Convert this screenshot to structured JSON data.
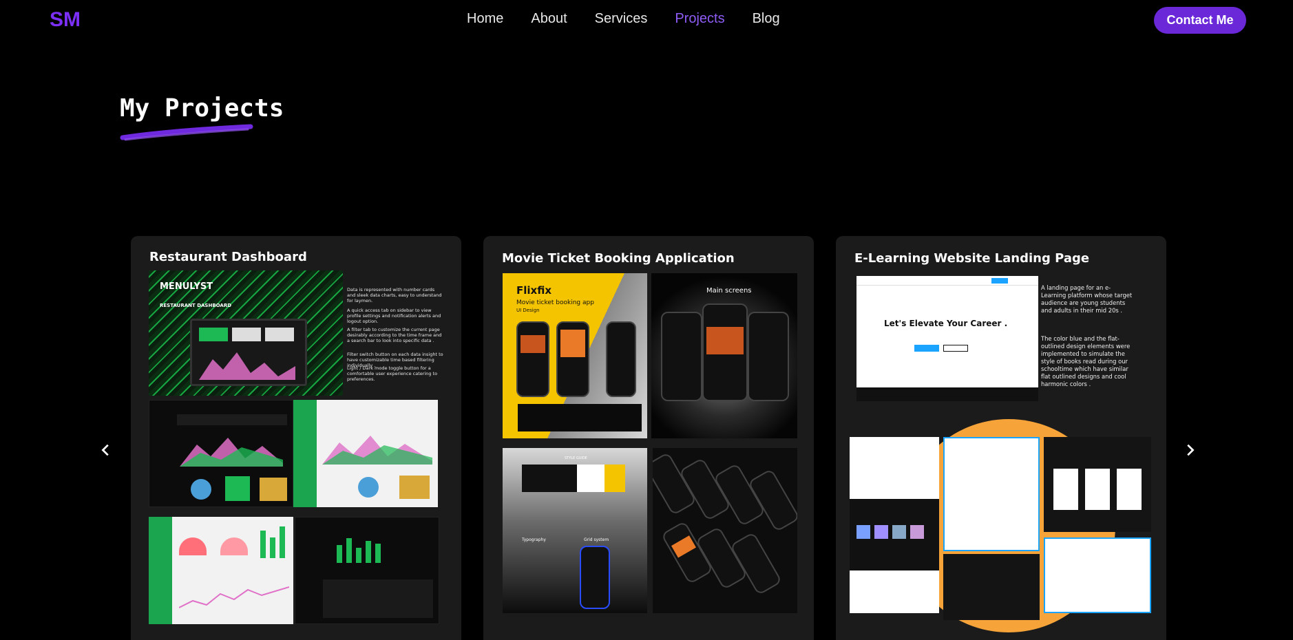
{
  "nav": {
    "logo": "SM",
    "links": [
      "Home",
      "About",
      "Services",
      "Projects",
      "Blog"
    ],
    "active": "Projects",
    "contact_label": "Contact Me"
  },
  "colors": {
    "accent": "#6a28d9",
    "logo": "#7b2ff7",
    "active_link": "#8f5cf6",
    "card_bg": "#1b1b1b",
    "bg": "#000000"
  },
  "section": {
    "title": "My Projects"
  },
  "projects": [
    {
      "title": "Restaurant Dashboard",
      "art": {
        "brand": "MENULYST",
        "brand_sub": "RESTAURANT DASHBOARD",
        "notes": [
          "Data is represented with number cards and sleek data charts, easy to understand for laymen.",
          "A quick access tab on sidebar to view profile settings and notification alerts and logout option.",
          "A filter tab to customize the current page desirably according to the time frame and a search bar to look into specific data .",
          "Filter switch button on each data insight to have customizable time based filtering individually .",
          "Light / Dark mode toggle button for a comfortable user experience catering to preferences."
        ]
      }
    },
    {
      "title": "Movie Ticket Booking Application",
      "art": {
        "brand": "Flixfix",
        "tagline": "Movie ticket booking app",
        "tag2": "UI Design",
        "main_screens": "Main screens",
        "style_guide": "STYLE GUIDE",
        "typography": "Typography",
        "grid": "Grid system"
      }
    },
    {
      "title": "E-Learning Website Landing Page",
      "art": {
        "headline": "Let's Elevate Your Career .",
        "desc1": "A landing page for an e-Learning platform whose target audience are young students and adults in their mid 20s .",
        "desc2": "The color blue and the flat-outlined design elements were implemented to simulate the style of books read during our schooltime which have similar flat outlined designs and cool harmonic colors ."
      }
    }
  ],
  "carousel": {
    "prev_icon": "chevron-left-icon",
    "next_icon": "chevron-right-icon"
  }
}
